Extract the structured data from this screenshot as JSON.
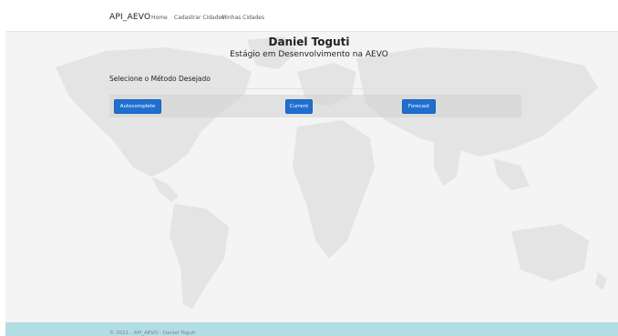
{
  "navbar": {
    "brand": "API_AEVO",
    "links": [
      {
        "label": "Home"
      },
      {
        "label": "Cadastrar Cidades"
      },
      {
        "label": "Minhas Cidades"
      }
    ]
  },
  "header": {
    "title": "Daniel Toguti",
    "subtitle": "Estágio em Desenvolvimento na AEVO"
  },
  "main": {
    "method_label": "Selecione o Método Desejado",
    "buttons": [
      {
        "label": "Autocomplete"
      },
      {
        "label": "Current"
      },
      {
        "label": "Forecast"
      }
    ]
  },
  "footer": {
    "text": "© 2021 - API_AEVO - Daniel Toguti"
  },
  "colors": {
    "primary_button": "#1f6fd1",
    "footer_bg": "#b2dde2",
    "map_land": "#e3e3e3"
  }
}
